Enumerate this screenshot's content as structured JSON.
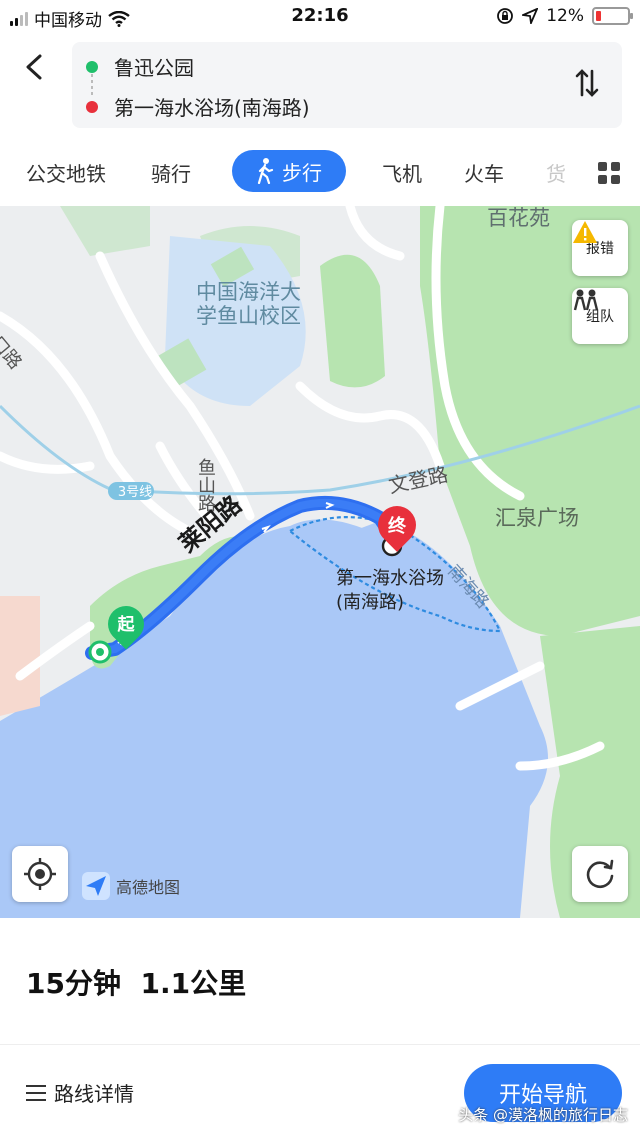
{
  "status_bar": {
    "carrier": "中国移动",
    "time": "22:16",
    "battery": "12%"
  },
  "route": {
    "origin": "鲁迅公园",
    "destination": "第一海水浴场(南海路)",
    "origin_color": "#1fbf6b",
    "destination_color": "#e8303c"
  },
  "tabs": [
    {
      "label": "公交地铁"
    },
    {
      "label": "骑行"
    },
    {
      "label": "步行",
      "active": true
    },
    {
      "label": "飞机"
    },
    {
      "label": "火车"
    },
    {
      "label": "货"
    }
  ],
  "map": {
    "labels": {
      "baihuayuan": "百花苑",
      "ocean_univ": "中国海洋大",
      "ocean_univ2": "学鱼山校区",
      "longkou": "龙口路",
      "metro_line": "3号线",
      "yushan": "鱼山路",
      "wendeng": "文登路",
      "huiquan": "汇泉广场",
      "laiyang": "莱阳路",
      "beach": "第一海水浴场",
      "beach2": "(南海路)",
      "nanhai": "南海路",
      "start_marker": "起",
      "end_marker": "终",
      "logo": "高德地图"
    },
    "buttons": {
      "report": "报错",
      "team": "组队"
    },
    "colors": {
      "water": "#aac8f7",
      "green": "#b7e4b0",
      "route": "#2e6ff0"
    }
  },
  "summary": {
    "duration": "15分钟",
    "distance": "1.1公里",
    "details_label": "路线详情",
    "start_nav_label": "开始导航"
  },
  "watermark": "头条 @漠洛枫的旅行日志"
}
